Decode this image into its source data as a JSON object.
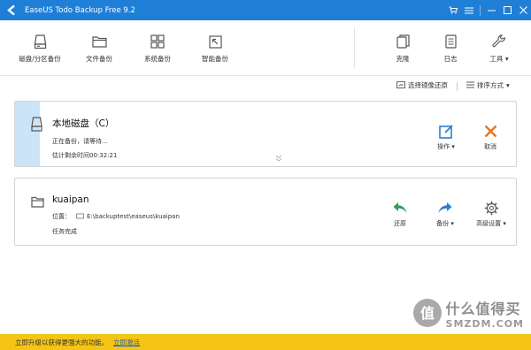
{
  "window": {
    "title": "EaseUS Todo Backup Free 9.2"
  },
  "toolbar": {
    "items": [
      {
        "label": "磁盘/分区备份",
        "icon": "disk-icon"
      },
      {
        "label": "文件备份",
        "icon": "folder-icon"
      },
      {
        "label": "系统备份",
        "icon": "windows-icon"
      },
      {
        "label": "智能备份",
        "icon": "smart-arrow-icon"
      }
    ],
    "right": [
      {
        "label": "克隆",
        "icon": "clone-icon"
      },
      {
        "label": "日志",
        "icon": "log-icon"
      },
      {
        "label": "工具",
        "icon": "wrench-icon"
      }
    ]
  },
  "sortbar": {
    "mirror_restore": "选择镜像还原",
    "sort": "排序方式"
  },
  "task1": {
    "name": "本地磁盘（C）",
    "status": "正在备份，请等待...",
    "eta": "估计剩余时间00:32:21",
    "actions": {
      "operate": "操作",
      "cancel": "取消"
    }
  },
  "task2": {
    "name": "kuaipan",
    "location_label": "位置：",
    "location": "E:\\backuptest\\easeus\\kuaipan",
    "status": "任务完成",
    "actions": {
      "restore": "还原",
      "backup": "备份",
      "advanced": "高级设置"
    }
  },
  "bottombar": {
    "text": "立即升级以获得更强大的功能。",
    "link": "立即激活"
  },
  "watermark": {
    "cn": "什么值得买",
    "en": "SMZDM.COM"
  },
  "colors": {
    "titlebar": "#1f7fd6",
    "accent": "#2b7fd4",
    "cancel": "#e8731d",
    "restore": "#2e9e5b",
    "bottombar": "#f5c516"
  }
}
